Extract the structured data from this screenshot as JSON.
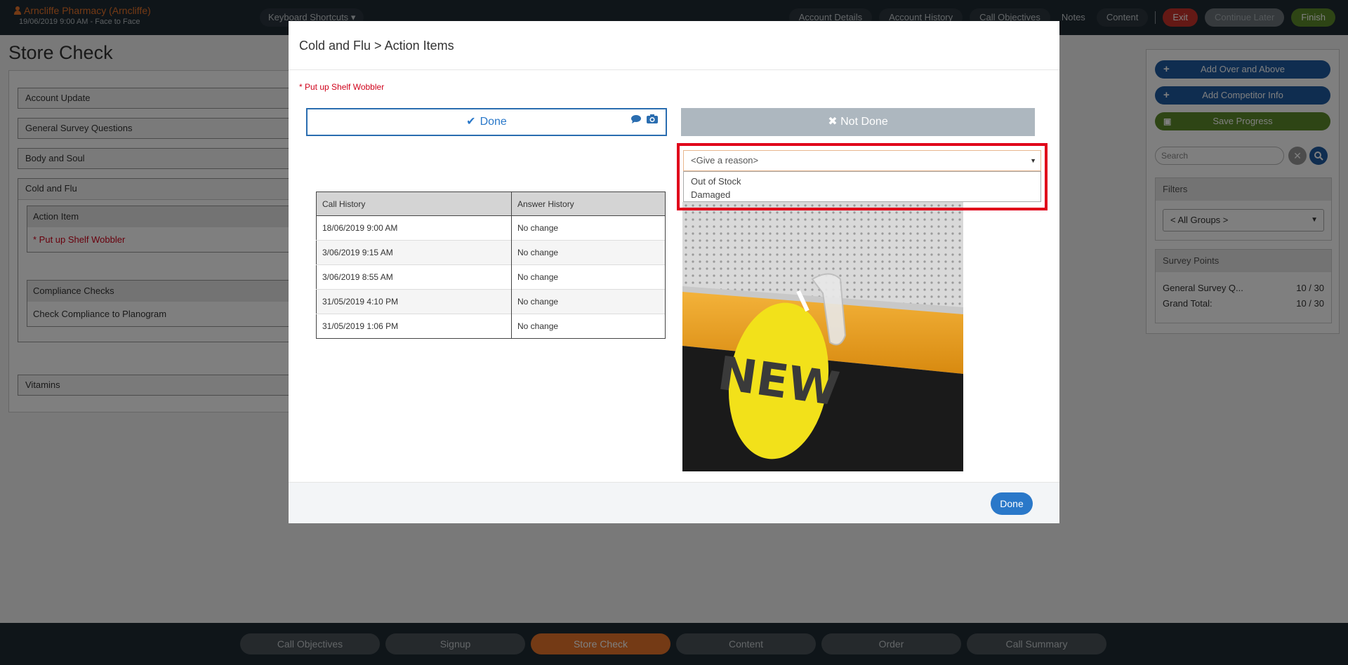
{
  "header": {
    "account_name": "Arncliffe Pharmacy (Arncliffe)",
    "account_subtitle": "19/06/2019 9:00 AM - Face to Face",
    "keyboard_shortcuts": "Keyboard Shortcuts",
    "nav": {
      "account_details": "Account Details",
      "account_history": "Account History",
      "call_objectives": "Call Objectives",
      "notes": "Notes",
      "content": "Content",
      "exit": "Exit",
      "continue_later": "Continue Later",
      "finish": "Finish"
    }
  },
  "page": {
    "title": "Store Check",
    "sections": {
      "account_update": "Account Update",
      "general_survey": "General Survey Questions",
      "body_and_soul": "Body and Soul",
      "cold_and_flu": "Cold and Flu",
      "vitamins": "Vitamins"
    },
    "action_item": {
      "header": "Action Item",
      "item": "* Put up Shelf Wobbler"
    },
    "compliance": {
      "header": "Compliance Checks",
      "item": "Check Compliance to Planogram"
    }
  },
  "sidebar": {
    "add_over_above": "Add Over and Above",
    "add_competitor": "Add Competitor Info",
    "save_progress": "Save Progress",
    "search_placeholder": "Search",
    "filters_header": "Filters",
    "filter_value": "< All Groups >",
    "survey_points_header": "Survey Points",
    "survey_rows": [
      {
        "label": "General Survey Q...",
        "value": "10 / 30"
      },
      {
        "label": "Grand Total:",
        "value": "10 / 30"
      }
    ]
  },
  "bottom_tabs": {
    "call_objectives": "Call Objectives",
    "signup": "Signup",
    "store_check": "Store Check",
    "content": "Content",
    "order": "Order",
    "call_summary": "Call Summary"
  },
  "modal": {
    "title": "Cold and Flu > Action Items",
    "required_label": "* Put up Shelf Wobbler",
    "done_label": "Done",
    "not_done_label": "Not Done",
    "history_headers": {
      "call": "Call History",
      "answer": "Answer History"
    },
    "history_rows": [
      {
        "call": "18/06/2019 9:00 AM",
        "answer": "No change"
      },
      {
        "call": "3/06/2019 9:15 AM",
        "answer": "No change"
      },
      {
        "call": "3/06/2019 8:55 AM",
        "answer": "No change"
      },
      {
        "call": "31/05/2019 4:10 PM",
        "answer": "No change"
      },
      {
        "call": "31/05/2019 1:06 PM",
        "answer": "No change"
      }
    ],
    "reason_placeholder": "<Give a reason>",
    "reason_options": [
      "Out of Stock",
      "Damaged"
    ],
    "image_text": "NEW",
    "footer_done": "Done"
  },
  "colors": {
    "accent_blue": "#2a78c9",
    "accent_orange": "#e8742a",
    "highlight_red": "#e0001a",
    "exit_red": "#c9332b",
    "finish_green": "#5c8a2a"
  }
}
